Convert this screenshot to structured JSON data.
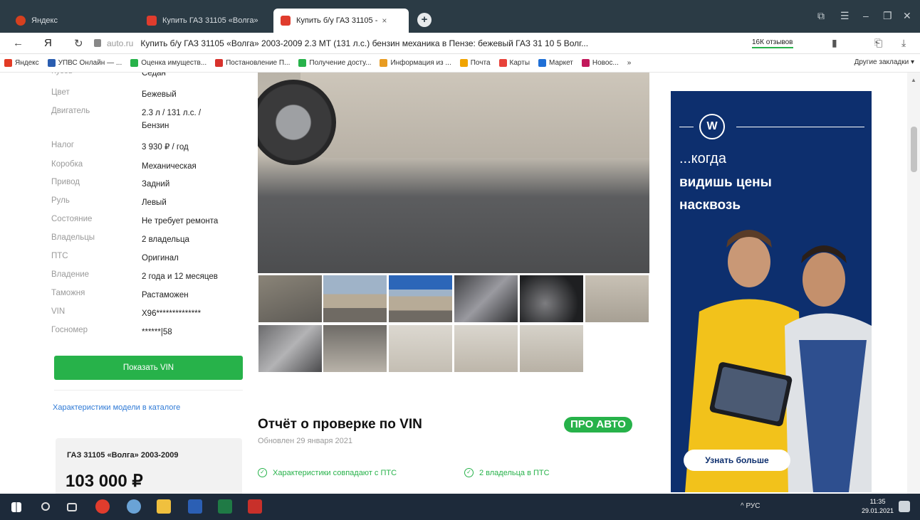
{
  "browser": {
    "tabs": [
      {
        "label": "Яндекс",
        "active": false
      },
      {
        "label": "Купить ГАЗ 31105 «Волга»",
        "active": false
      },
      {
        "label": "Купить б/у ГАЗ 31105 -",
        "active": true
      }
    ],
    "tab_close": "×",
    "new_tab": "+",
    "url_domain": "auto.ru",
    "url_title": "Купить б/у ГАЗ 31105 «Волга» 2003-2009 2.3 MT (131 л.с.) бензин механика в Пензе: бежевый ГАЗ 31 10 5 Волг...",
    "reviews_badge": "16К отзывов",
    "bookmarks": [
      {
        "label": "Яндекс",
        "color": "#e23b25"
      },
      {
        "label": "УПВС Онлайн — ...",
        "color": "#2a5db0"
      },
      {
        "label": "Оценка имуществ...",
        "color": "#27b24a"
      },
      {
        "label": "Постановление П...",
        "color": "#d8322d"
      },
      {
        "label": "Получение досту...",
        "color": "#27b24a"
      },
      {
        "label": "Информация из ...",
        "color": "#e89c22"
      },
      {
        "label": "Почта",
        "color": "#f1a400"
      },
      {
        "label": "Карты",
        "color": "#e8423a"
      },
      {
        "label": "Маркет",
        "color": "#1f6fd6"
      },
      {
        "label": "Новос...",
        "color": "#c2185b"
      },
      {
        "label": "»",
        "color": "#ffffff"
      }
    ],
    "other_bookmarks": "Другие закладки ▾"
  },
  "specs": [
    {
      "key": "Кузов",
      "value": "Седан"
    },
    {
      "key": "Цвет",
      "value": "Бежевый"
    },
    {
      "key": "Двигатель",
      "value": "2.3 л / 131 л.с. / Бензин"
    },
    {
      "key": "Налог",
      "value": "3 930 ₽ / год"
    },
    {
      "key": "Коробка",
      "value": "Механическая"
    },
    {
      "key": "Привод",
      "value": "Задний"
    },
    {
      "key": "Руль",
      "value": "Левый"
    },
    {
      "key": "Состояние",
      "value": "Не требует ремонта"
    },
    {
      "key": "Владельцы",
      "value": "2 владельца"
    },
    {
      "key": "ПТС",
      "value": "Оригинал"
    },
    {
      "key": "Владение",
      "value": "2 года и 12 месяцев"
    },
    {
      "key": "Таможня",
      "value": "Растаможен"
    },
    {
      "key": "VIN",
      "value": "X96**************"
    },
    {
      "key": "Госномер",
      "value": "******|58"
    }
  ],
  "actions": {
    "show_vin": "Показать VIN",
    "catalog_link": "Характеристики модели в каталоге"
  },
  "price_card": {
    "model": "ГАЗ 31105 «Волга» 2003-2009",
    "price": "103 000 ₽"
  },
  "report": {
    "title": "Отчёт о проверке по VIN",
    "updated": "Обновлен 29 января 2021",
    "badge": "ПРО АВТО",
    "checks": [
      {
        "label": "Характеристики совпадают с ПТС"
      },
      {
        "label": "2 владельца в ПТС"
      }
    ]
  },
  "ad": {
    "line1": "...когда",
    "line2": "видишь цены",
    "line3": "насквозь",
    "button": "Узнать больше"
  },
  "taskbar": {
    "tray_text": "^  РУС",
    "time": "11:35",
    "date": "29.01.2021"
  },
  "colors": {
    "accent_green": "#27b24a",
    "link_blue": "#2f7ad6",
    "ad_blue": "#0d2f6e",
    "tabbar": "#2b3b45"
  }
}
